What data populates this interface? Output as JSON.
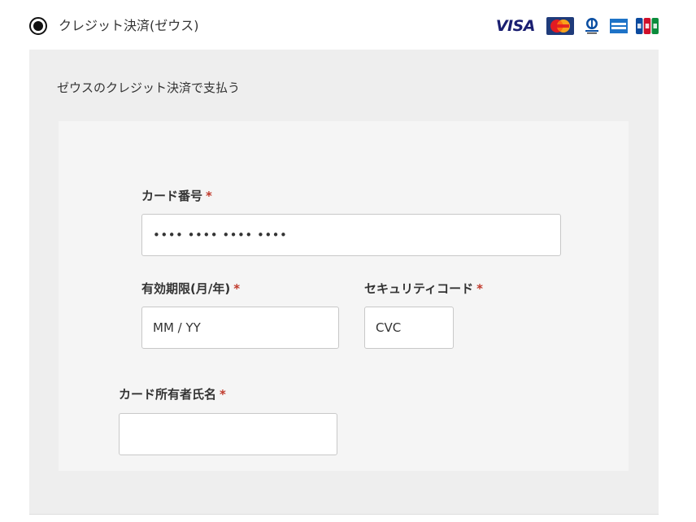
{
  "payment_method": {
    "label": "クレジット決済(ゼウス)",
    "selected": true,
    "card_brands": [
      "VISA",
      "MasterCard",
      "Diners Club",
      "American Express",
      "JCB"
    ],
    "visa_text": "VISA"
  },
  "panel": {
    "description": "ゼウスのクレジット決済で支払う"
  },
  "form": {
    "card_number": {
      "label": "カード番号",
      "value": "•••• •••• •••• ••••"
    },
    "expiry": {
      "label": "有効期限(月/年)",
      "placeholder": "MM / YY"
    },
    "cvc": {
      "label": "セキュリティコード",
      "placeholder": "CVC"
    },
    "holder_name": {
      "label": "カード所有者氏名",
      "value": ""
    },
    "required_mark": "*"
  },
  "colors": {
    "panel_bg": "#eeeeee",
    "form_bg": "#f5f5f5",
    "required": "#c0392b",
    "visa": "#1a1f71"
  }
}
